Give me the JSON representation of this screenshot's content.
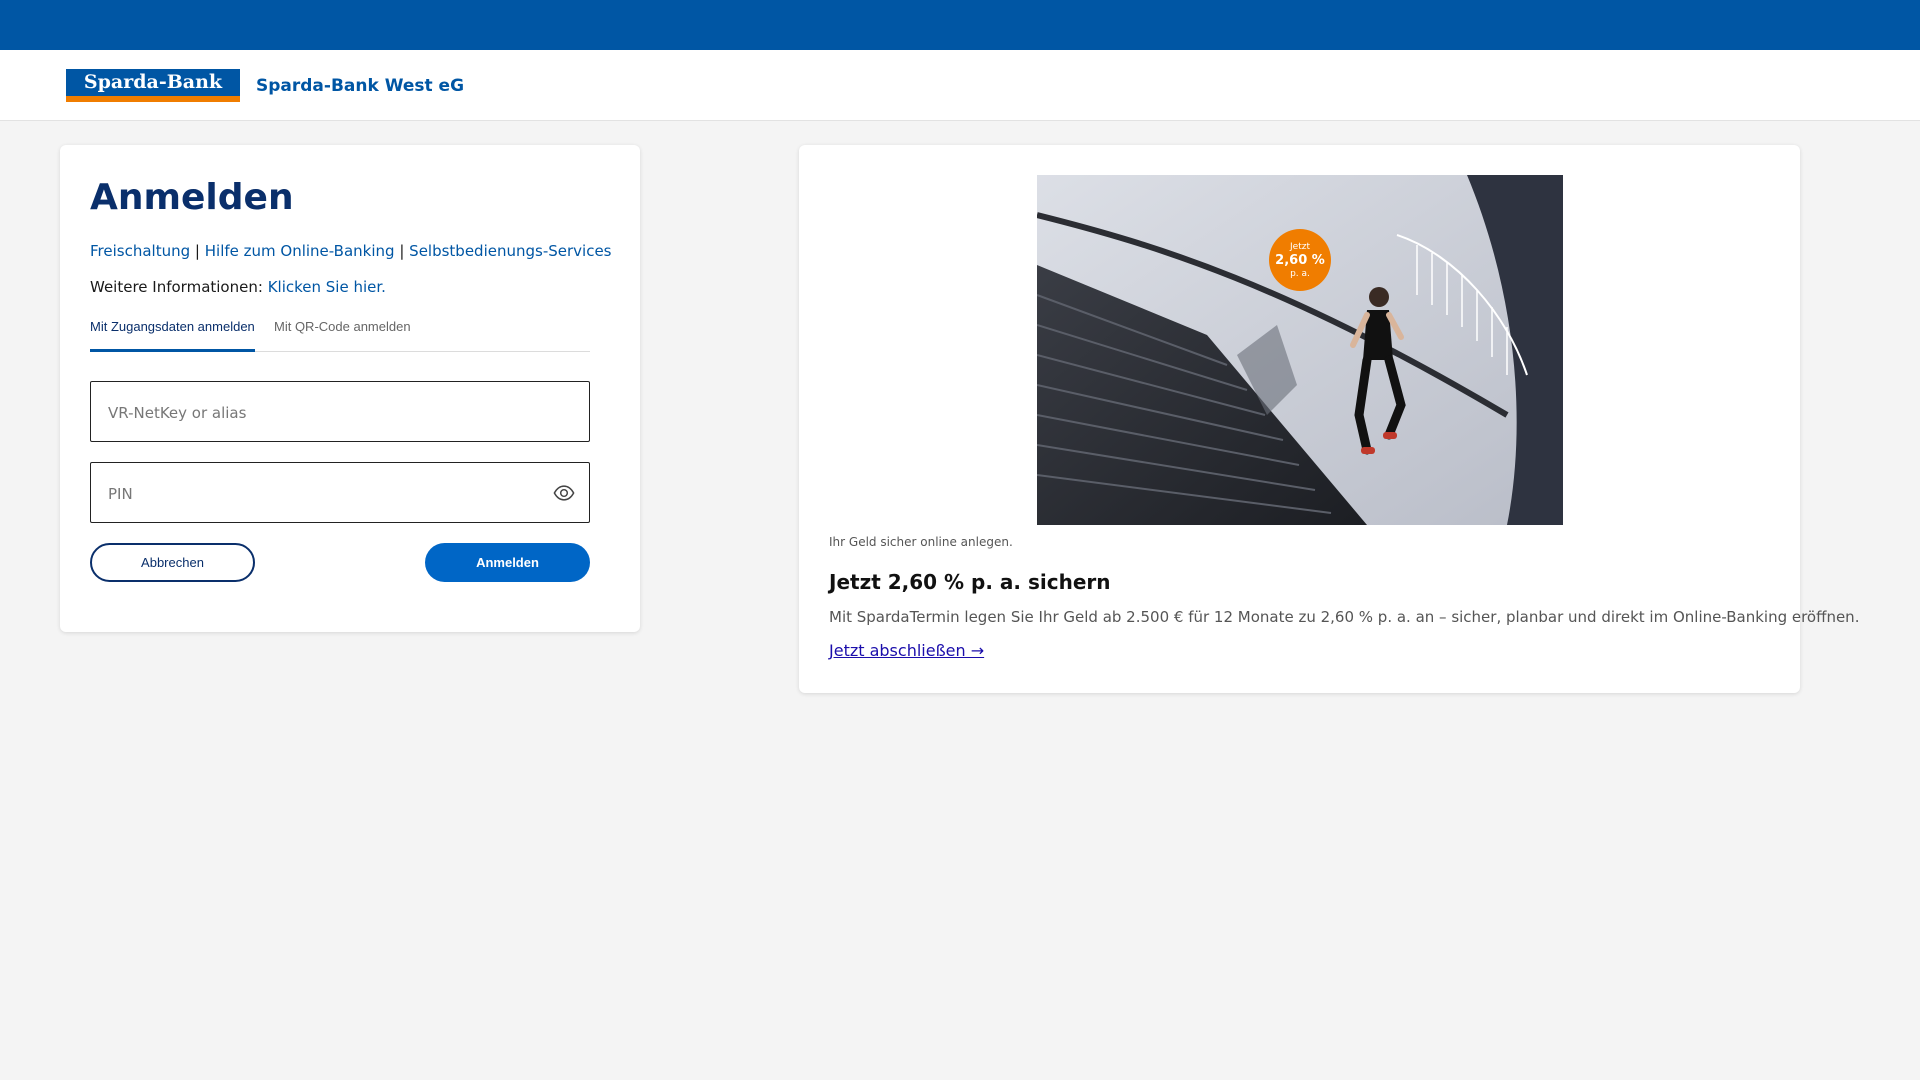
{
  "header": {
    "logo_text": "Sparda-Bank",
    "bank_name": "Sparda-Bank West eG"
  },
  "login": {
    "title": "Anmelden",
    "links": [
      "Freischaltung",
      "Hilfe zum Online-Banking",
      "Selbstbedienungs-Services"
    ],
    "separator": "|",
    "info_label": "Weitere Informationen:",
    "info_link": "Klicken Sie hier.",
    "tabs": [
      {
        "label": "Mit Zugangsdaten anmelden",
        "active": true
      },
      {
        "label": "Mit QR-Code anmelden",
        "active": false
      }
    ],
    "username_placeholder": "VR-NetKey or alias",
    "pin_placeholder": "PIN",
    "cancel_label": "Abbrechen",
    "submit_label": "Anmelden"
  },
  "promo": {
    "badge_line1": "Jetzt",
    "badge_line2": "2,60 %",
    "badge_line3": "p. a.",
    "caption": "Ihr Geld sicher online anlegen.",
    "title": "Jetzt 2,60 % p. a. sichern",
    "text": "Mit SpardaTermin legen Sie Ihr Geld ab 2.500 € für 12 Monate zu 2,60 % p. a. an – sicher, planbar und direkt im Online-Banking eröffnen.",
    "link": "Jetzt abschließen →"
  },
  "colors": {
    "brand_blue": "#0056a4",
    "brand_orange": "#f07d00",
    "title_navy": "#0a2f6b",
    "button_blue": "#0066c6"
  }
}
